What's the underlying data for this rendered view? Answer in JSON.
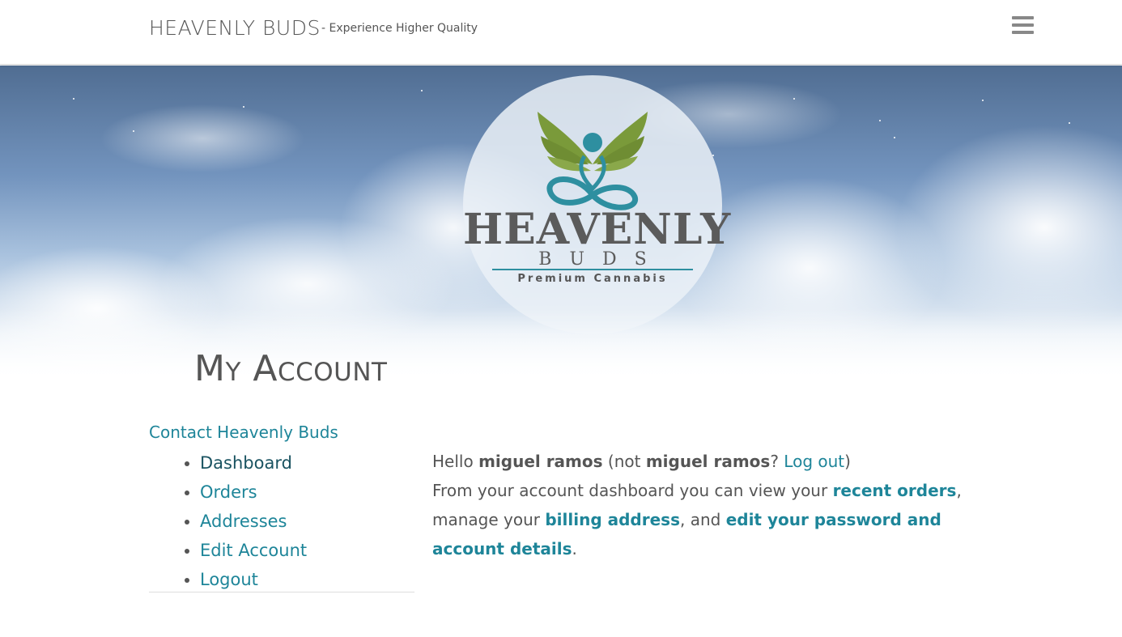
{
  "header": {
    "site_title": "HEAVENLY BUDS",
    "tagline": "- Experience Higher Quality",
    "menu_icon": "hamburger-menu-icon"
  },
  "hero": {
    "logo_lines": [
      "HEAVENLY",
      "BUDS",
      "Premium Cannabis"
    ],
    "logo_icon": "winged-leaf-figure-icon"
  },
  "page_title": "My Account",
  "nav": {
    "heading": "Contact Heavenly Buds",
    "items": [
      {
        "label": "Dashboard",
        "active": true
      },
      {
        "label": "Orders",
        "active": false
      },
      {
        "label": "Addresses",
        "active": false
      },
      {
        "label": "Edit Account",
        "active": false
      },
      {
        "label": "Logout",
        "active": false
      }
    ]
  },
  "content": {
    "greeting_hello": "Hello",
    "user_name": "miguel ramos",
    "not_prefix": "(not",
    "not_user_name": "miguel ramos",
    "not_suffix": "?",
    "logout_link": "Log out",
    "close_paren": ")",
    "intro": "From your account dashboard you can view your",
    "recent_orders_link": "recent orders",
    "manage_text": ", manage your",
    "billing_link": "billing address",
    "and_text": ", and",
    "edit_link": "edit your password and account details",
    "period": "."
  },
  "colors": {
    "link": "#1e8599",
    "active_link": "#1a5361",
    "text": "#555555",
    "logo_teal": "#2e8fa0",
    "logo_green": "#7a9a3a"
  }
}
